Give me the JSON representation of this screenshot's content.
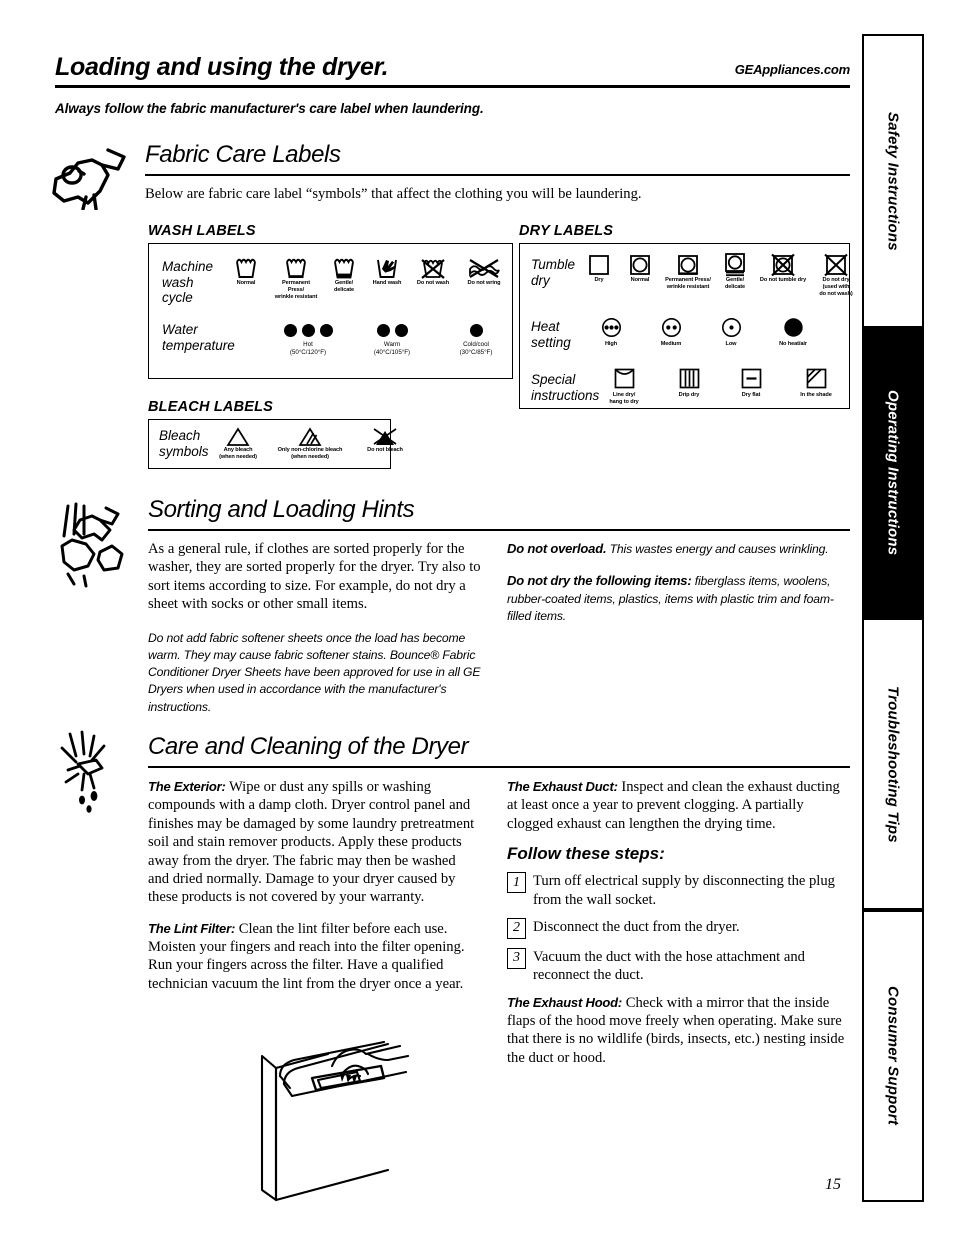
{
  "header": {
    "title": "Loading and using the dryer.",
    "url": "GEAppliances.com",
    "subtitle": "Always follow the fabric manufacturer's care label when laundering."
  },
  "sections": {
    "fabric_care": {
      "title": "Fabric Care Labels",
      "intro": "Below are fabric care label “symbols” that affect the clothing you will be laundering.",
      "icon": "shirt-hanger-icon"
    },
    "sorting": {
      "title": "Sorting and Loading Hints",
      "icon": "sorting-clothes-icon"
    },
    "care": {
      "title": "Care and Cleaning of the Dryer",
      "icon": "spray-cleaning-icon"
    }
  },
  "wash_labels": {
    "heading": "WASH LABELS",
    "rows": [
      {
        "label": "Machine\nwash\ncycle",
        "symbols": [
          {
            "name": "wash-normal-icon",
            "caption": "Normal"
          },
          {
            "name": "wash-permanent-press-icon",
            "caption": "Permanent Press/\nwrinkle resistant"
          },
          {
            "name": "wash-gentle-icon",
            "caption": "Gentle/\ndelicate"
          },
          {
            "name": "hand-wash-icon",
            "caption": "Hand wash"
          },
          {
            "name": "do-not-wash-icon",
            "caption": "Do not wash"
          },
          {
            "name": "do-not-wring-icon",
            "caption": "Do not wring"
          }
        ]
      },
      {
        "label": "Water\ntemperature",
        "symbols": [
          {
            "name": "water-hot-icon",
            "dots": 3,
            "caption": "Hot",
            "caption2": "(50°C/120°F)"
          },
          {
            "name": "water-warm-icon",
            "dots": 2,
            "caption": "Warm",
            "caption2": "(40°C/105°F)"
          },
          {
            "name": "water-cold-icon",
            "dots": 1,
            "caption": "Cold/cool",
            "caption2": "(30°C/85°F)"
          }
        ]
      }
    ]
  },
  "bleach_labels": {
    "heading": "BLEACH LABELS",
    "row_label": "Bleach\nsymbols",
    "symbols": [
      {
        "name": "any-bleach-icon",
        "caption": "Any bleach\n(when needed)"
      },
      {
        "name": "non-chlorine-bleach-icon",
        "caption": "Only non-chlorine bleach\n(when needed)"
      },
      {
        "name": "do-not-bleach-icon",
        "caption": "Do not bleach"
      }
    ]
  },
  "dry_labels": {
    "heading": "DRY LABELS",
    "rows": [
      {
        "label": "Tumble\ndry",
        "symbols": [
          {
            "name": "dry-icon",
            "caption": "Dry"
          },
          {
            "name": "tumble-dry-normal-icon",
            "caption": "Normal"
          },
          {
            "name": "tumble-dry-permanent-press-icon",
            "caption": "Permanent Press/\nwrinkle resistant"
          },
          {
            "name": "tumble-dry-gentle-icon",
            "caption": "Gentle/\ndelicate"
          },
          {
            "name": "do-not-tumble-dry-icon",
            "caption": "Do not tumble dry"
          },
          {
            "name": "do-not-dry-icon",
            "caption": "Do not dry\n(used with\ndo not wash)"
          }
        ]
      },
      {
        "label": "Heat\nsetting",
        "symbols": [
          {
            "name": "heat-high-icon",
            "caption": "High"
          },
          {
            "name": "heat-medium-icon",
            "caption": "Medium"
          },
          {
            "name": "heat-low-icon",
            "caption": "Low"
          },
          {
            "name": "heat-none-icon",
            "caption": "No heat/air"
          }
        ]
      },
      {
        "label": "Special\ninstructions",
        "symbols": [
          {
            "name": "line-dry-icon",
            "caption": "Line dry/\nhang to dry"
          },
          {
            "name": "drip-dry-icon",
            "caption": "Drip dry"
          },
          {
            "name": "dry-flat-icon",
            "caption": "Dry flat"
          },
          {
            "name": "dry-in-shade-icon",
            "caption": "In the shade"
          }
        ]
      }
    ]
  },
  "sorting_text": {
    "left_p1": "As a general rule, if clothes are sorted properly for the washer, they are sorted properly for the dryer. Try also to sort items according to size. For example, do not dry a sheet with socks or other small items.",
    "left_p2": "Do not add fabric softener sheets once the load has become warm. They may cause fabric softener stains. Bounce® Fabric Conditioner Dryer Sheets have been approved for use in all GE Dryers when used in accordance with the manufacturer's instructions.",
    "right_p1_lead": "Do not overload.",
    "right_p1_body": "This wastes energy and causes wrinkling.",
    "right_p2_lead": "Do not dry the following items:",
    "right_p2_body": "fiberglass items, woolens, rubber-coated items, plastics, items with plastic trim and foam-filled items."
  },
  "care_text": {
    "exterior_lead": "The Exterior:",
    "exterior_body": "Wipe or dust any spills or washing compounds with a damp cloth. Dryer control panel and finishes may be damaged by some laundry pretreatment soil and stain remover products. Apply these products away from the dryer. The fabric may then be washed and dried normally. Damage to your dryer caused by these products is not covered by your warranty.",
    "lint_lead": "The Lint Filter:",
    "lint_body": "Clean the lint filter before each use. Moisten your fingers and reach into the filter opening. Run your fingers across the filter. Have a qualified technician vacuum the lint from the dryer once a year.",
    "duct_lead": "The Exhaust Duct:",
    "duct_body": "Inspect and clean the exhaust ducting at least once a year to prevent clogging. A partially clogged exhaust can lengthen the drying time.",
    "steps_heading": "Follow these steps:",
    "steps": [
      {
        "num": "1",
        "text": "Turn off electrical supply by disconnecting the plug from the wall socket."
      },
      {
        "num": "2",
        "text": "Disconnect the duct from the dryer."
      },
      {
        "num": "3",
        "text": "Vacuum the duct with the hose attachment and reconnect the duct."
      }
    ],
    "hood_lead": "The Exhaust Hood:",
    "hood_body": "Check with a mirror that the inside flaps of the hood move freely when operating. Make sure that there is no wildlife (birds, insects, etc.) nesting inside the duct or hood.",
    "illustration": "dryer-lint-filter-illustration"
  },
  "side_tabs": [
    {
      "label": "Safety Instructions",
      "active": false
    },
    {
      "label": "Operating Instructions",
      "active": true
    },
    {
      "label": "Troubleshooting Tips",
      "active": false
    },
    {
      "label": "Consumer Support",
      "active": false
    }
  ],
  "page_number": "15"
}
